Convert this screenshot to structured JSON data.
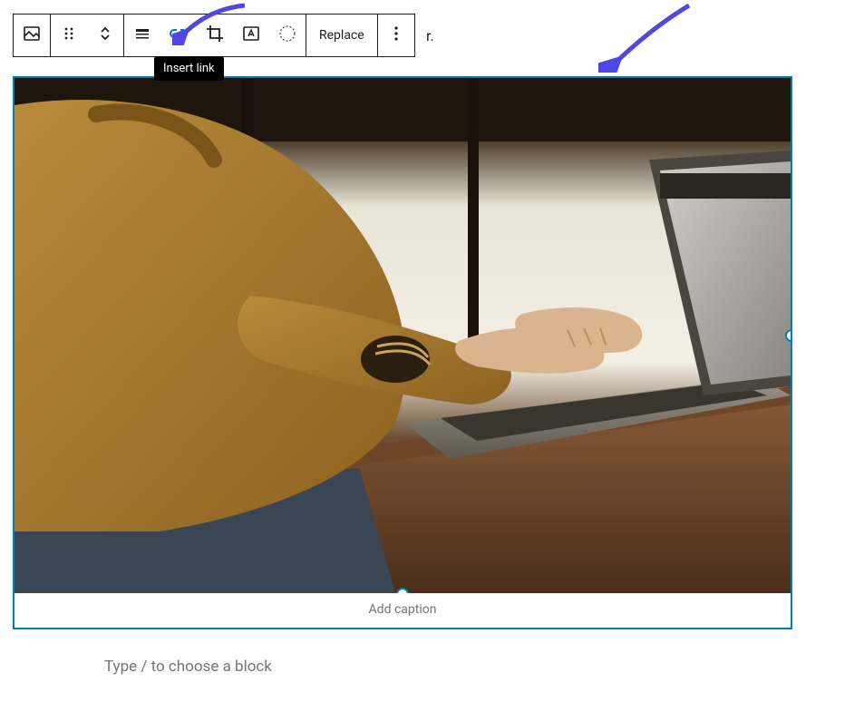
{
  "toolbar": {
    "replace_label": "Replace",
    "icons": {
      "image": "image-icon",
      "drag": "drag-handle-icon",
      "move": "move-up-down-icon",
      "align": "align-icon",
      "link": "link-icon",
      "crop": "crop-icon",
      "textoverlay": "text-overlay-icon",
      "duotone": "duotone-icon",
      "more": "more-options-icon"
    }
  },
  "tooltip": {
    "text": "Insert link"
  },
  "bg_fragment": "r.",
  "image_block": {
    "caption_placeholder": "Add caption"
  },
  "placeholder": {
    "text": "Type / to choose a block"
  },
  "colors": {
    "accent": "#007cba",
    "arrow": "#4f46e5"
  }
}
